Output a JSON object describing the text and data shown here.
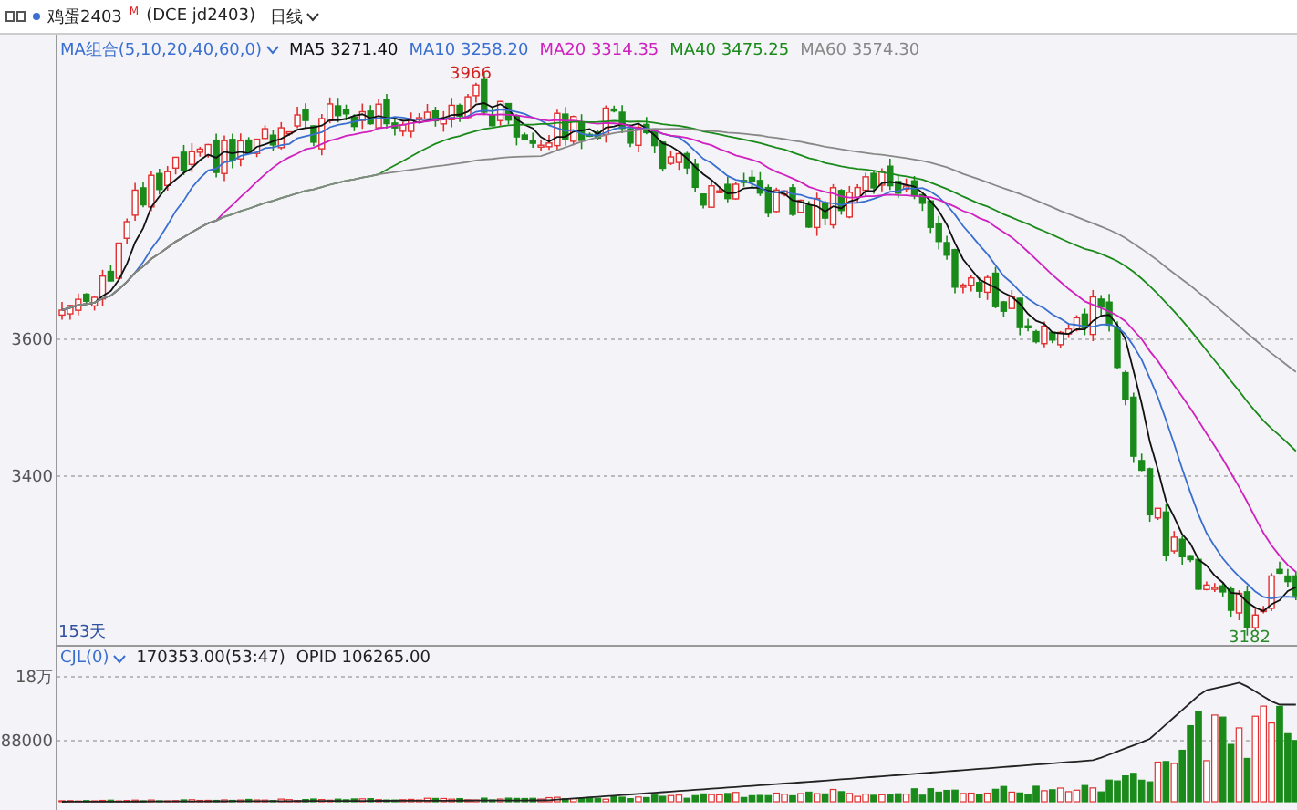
{
  "toolbar": {
    "symbol": "鸡蛋2403",
    "badge": "M",
    "code": "(DCE jd2403)",
    "period": "日线"
  },
  "price_pane": {
    "indicator": "MA组合(5,10,20,40,60,0)",
    "legend": [
      {
        "label": "MA5 3271.40",
        "color": "#111111"
      },
      {
        "label": "MA10 3258.20",
        "color": "#3a6fd0"
      },
      {
        "label": "MA20 3314.35",
        "color": "#d020c0"
      },
      {
        "label": "MA40 3475.25",
        "color": "#1a8a1a"
      },
      {
        "label": "MA60 3574.30",
        "color": "#888888"
      }
    ],
    "y_labels": [
      "3600",
      "3400"
    ],
    "high_label": "3966",
    "low_label": "3182",
    "days": "153天"
  },
  "volume_pane": {
    "indicator": "CJL(0)",
    "volume": "170353.00(53:47)",
    "open_interest": "OPID 106265.00",
    "y_labels": [
      "18万",
      "88000"
    ]
  }
}
